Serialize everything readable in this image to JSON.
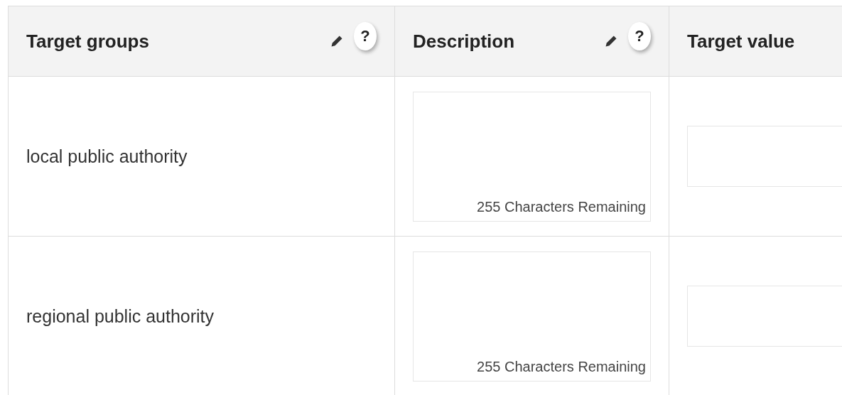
{
  "table": {
    "columns": [
      {
        "label": "Target groups",
        "editable": true,
        "help": "?"
      },
      {
        "label": "Description",
        "editable": true,
        "help": "?"
      },
      {
        "label": "Target value",
        "editable": false
      }
    ],
    "rows": [
      {
        "target_group": "local public authority",
        "counter": "255 Characters Remaining"
      },
      {
        "target_group": "regional public authority",
        "counter": "255 Characters Remaining"
      }
    ]
  }
}
